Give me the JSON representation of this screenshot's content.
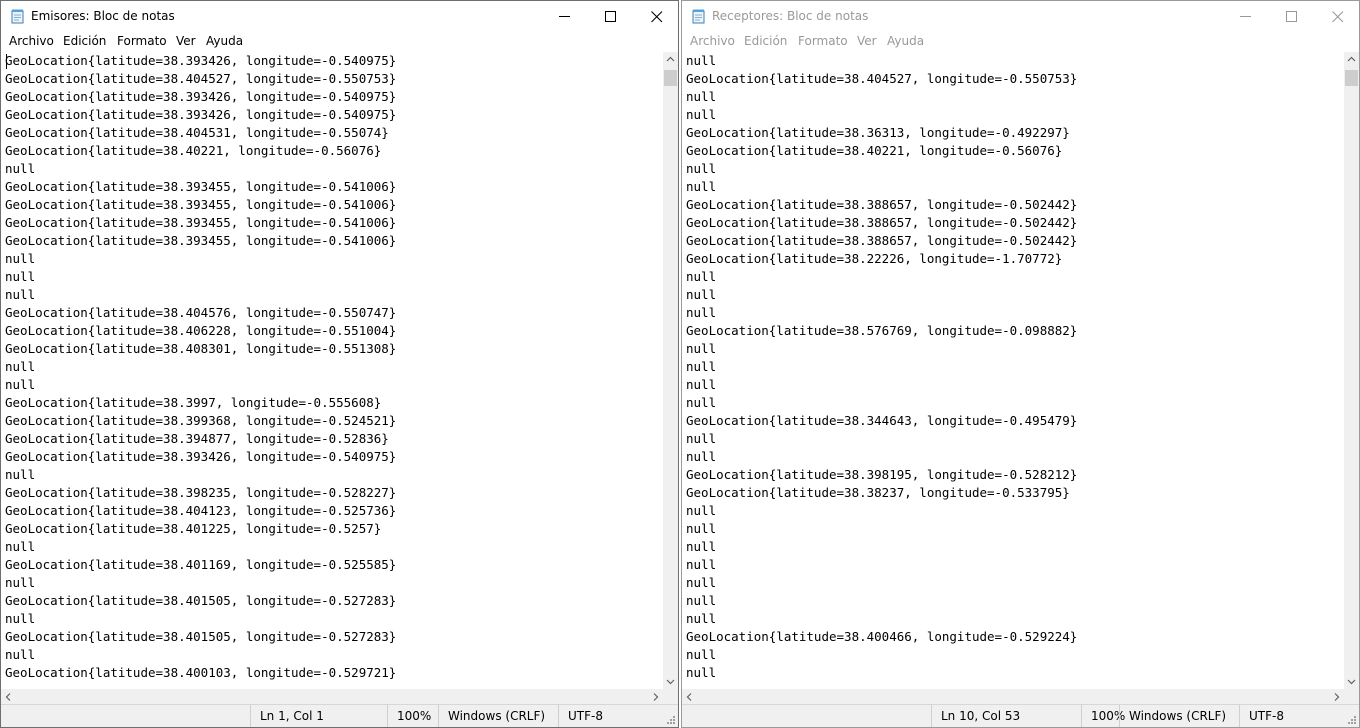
{
  "windows": [
    {
      "title": "Emisores: Bloc de notas",
      "menu": [
        "Archivo",
        "Edición",
        "Formato",
        "Ver",
        "Ayuda"
      ],
      "lines": [
        "GeoLocation{latitude=38.393426, longitude=-0.540975}",
        "GeoLocation{latitude=38.404527, longitude=-0.550753}",
        "GeoLocation{latitude=38.393426, longitude=-0.540975}",
        "GeoLocation{latitude=38.393426, longitude=-0.540975}",
        "GeoLocation{latitude=38.404531, longitude=-0.55074}",
        "GeoLocation{latitude=38.40221, longitude=-0.56076}",
        "null",
        "GeoLocation{latitude=38.393455, longitude=-0.541006}",
        "GeoLocation{latitude=38.393455, longitude=-0.541006}",
        "GeoLocation{latitude=38.393455, longitude=-0.541006}",
        "GeoLocation{latitude=38.393455, longitude=-0.541006}",
        "null",
        "null",
        "null",
        "GeoLocation{latitude=38.404576, longitude=-0.550747}",
        "GeoLocation{latitude=38.406228, longitude=-0.551004}",
        "GeoLocation{latitude=38.408301, longitude=-0.551308}",
        "null",
        "null",
        "GeoLocation{latitude=38.3997, longitude=-0.555608}",
        "GeoLocation{latitude=38.399368, longitude=-0.524521}",
        "GeoLocation{latitude=38.394877, longitude=-0.52836}",
        "GeoLocation{latitude=38.393426, longitude=-0.540975}",
        "null",
        "GeoLocation{latitude=38.398235, longitude=-0.528227}",
        "GeoLocation{latitude=38.404123, longitude=-0.525736}",
        "GeoLocation{latitude=38.401225, longitude=-0.5257}",
        "null",
        "GeoLocation{latitude=38.401169, longitude=-0.525585}",
        "null",
        "GeoLocation{latitude=38.401505, longitude=-0.527283}",
        "null",
        "GeoLocation{latitude=38.401505, longitude=-0.527283}",
        "null",
        "GeoLocation{latitude=38.400103, longitude=-0.529721}"
      ],
      "status": {
        "position": "Ln 1, Col 1",
        "zoom": "100%",
        "eol": "Windows (CRLF)",
        "encoding": "UTF-8"
      }
    },
    {
      "title": "Receptores: Bloc de notas",
      "menu": [
        "Archivo",
        "Edición",
        "Formato",
        "Ver",
        "Ayuda"
      ],
      "lines": [
        "null",
        "GeoLocation{latitude=38.404527, longitude=-0.550753}",
        "null",
        "null",
        "GeoLocation{latitude=38.36313, longitude=-0.492297}",
        "GeoLocation{latitude=38.40221, longitude=-0.56076}",
        "null",
        "null",
        "GeoLocation{latitude=38.388657, longitude=-0.502442}",
        "GeoLocation{latitude=38.388657, longitude=-0.502442}",
        "GeoLocation{latitude=38.388657, longitude=-0.502442}",
        "GeoLocation{latitude=38.22226, longitude=-1.70772}",
        "null",
        "null",
        "null",
        "GeoLocation{latitude=38.576769, longitude=-0.098882}",
        "null",
        "null",
        "null",
        "null",
        "GeoLocation{latitude=38.344643, longitude=-0.495479}",
        "null",
        "null",
        "GeoLocation{latitude=38.398195, longitude=-0.528212}",
        "GeoLocation{latitude=38.38237, longitude=-0.533795}",
        "null",
        "null",
        "null",
        "null",
        "null",
        "null",
        "null",
        "GeoLocation{latitude=38.400466, longitude=-0.529224}",
        "null",
        "null"
      ],
      "status": {
        "position": "Ln 10, Col 53",
        "zoom": "100%",
        "eol": "Windows (CRLF)",
        "encoding": "UTF-8"
      }
    }
  ]
}
